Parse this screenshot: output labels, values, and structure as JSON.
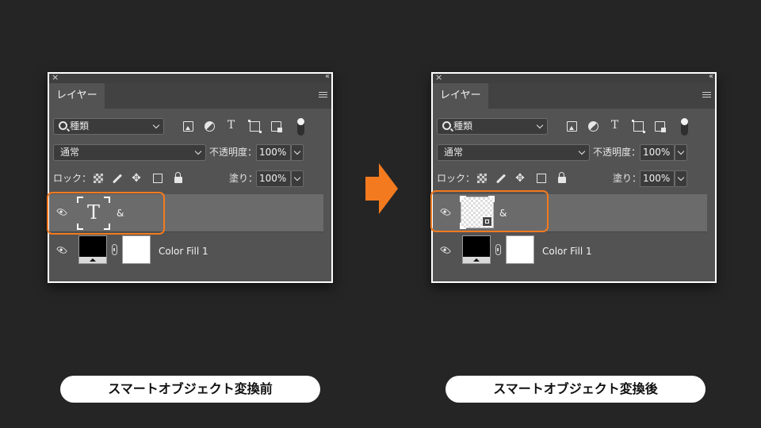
{
  "panels": [
    {
      "titlebar": {
        "close": "×",
        "collapse": "‹‹"
      },
      "tab_label": "レイヤー",
      "kind_filter": "種類",
      "blend_mode": "通常",
      "opacity_label": "不透明度：",
      "opacity_value": "100%",
      "lock_label": "ロック：",
      "fill_label": "塗り：",
      "fill_value": "100%",
      "layers": [
        {
          "name": "&",
          "kind": "type",
          "selected": true
        },
        {
          "name": "Color Fill 1",
          "kind": "fill",
          "selected": false
        }
      ],
      "caption": "スマートオブジェクト変換前"
    },
    {
      "titlebar": {
        "close": "×",
        "collapse": "‹‹"
      },
      "tab_label": "レイヤー",
      "kind_filter": "種類",
      "blend_mode": "通常",
      "opacity_label": "不透明度：",
      "opacity_value": "100%",
      "lock_label": "ロック：",
      "fill_label": "塗り：",
      "fill_value": "100%",
      "layers": [
        {
          "name": "&",
          "kind": "smart-object",
          "selected": true
        },
        {
          "name": "Color Fill 1",
          "kind": "fill",
          "selected": false
        }
      ],
      "caption": "スマートオブジェクト変換後"
    }
  ],
  "type_thumb_glyph": "T",
  "move_glyph": "✥",
  "colors": {
    "highlight": "#f47a1f",
    "panel": "#535353",
    "background": "#252525"
  }
}
